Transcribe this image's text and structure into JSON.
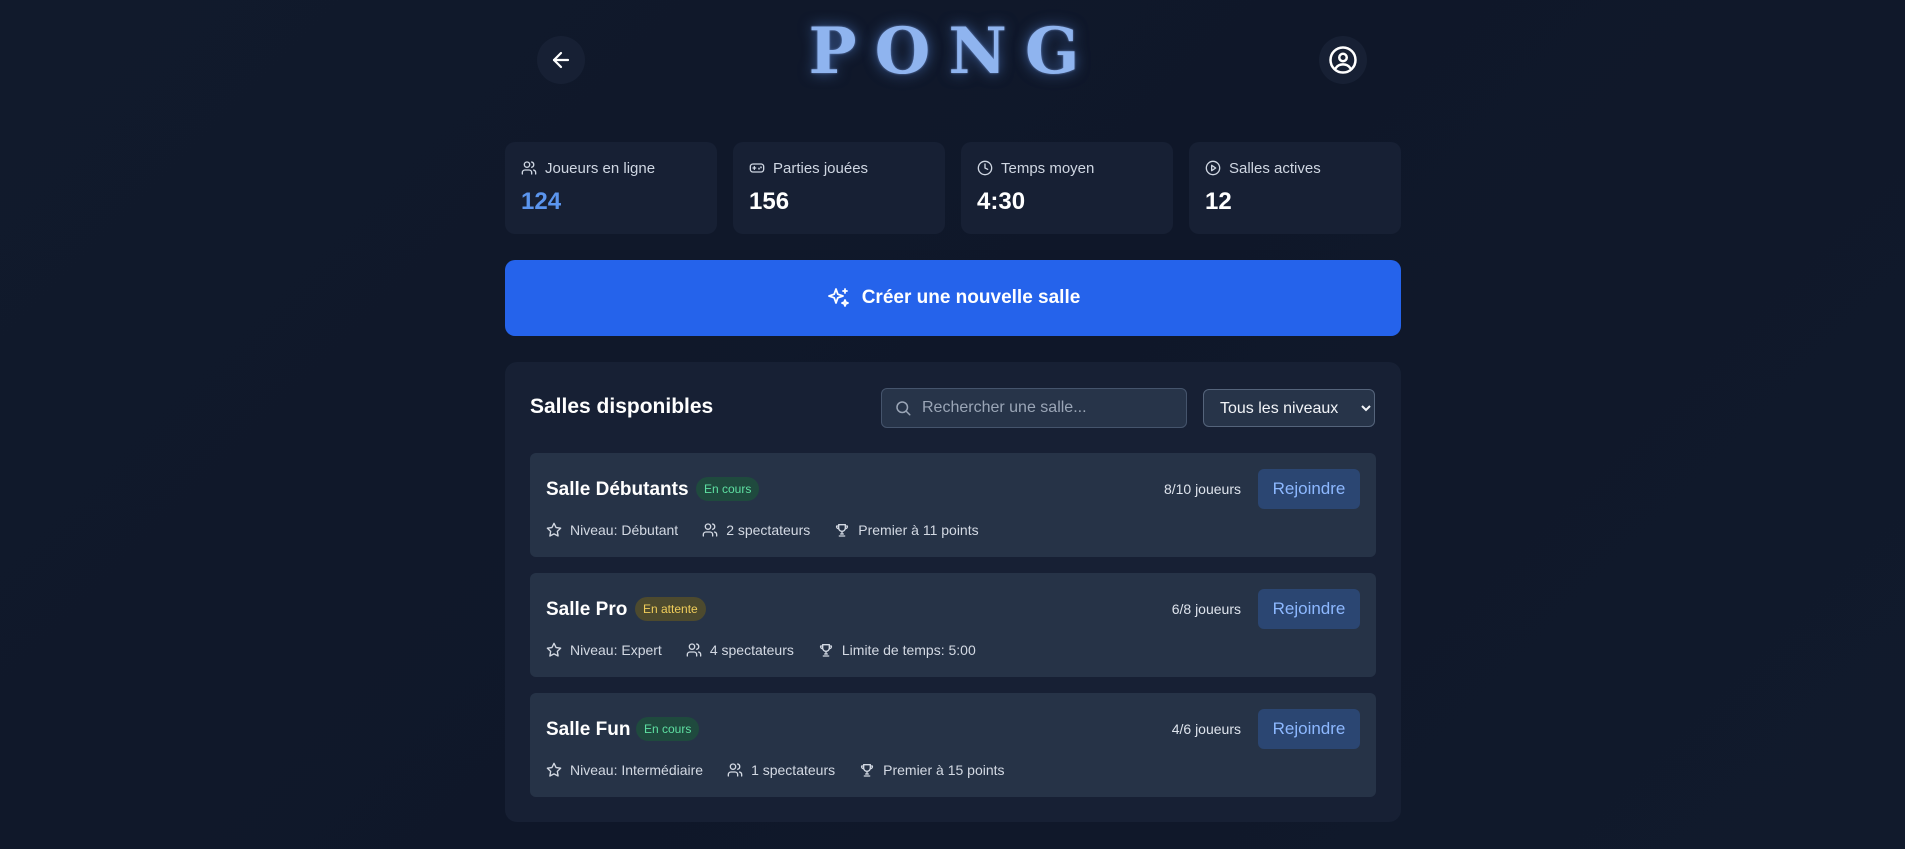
{
  "header": {
    "logo": "PONG",
    "back_icon": "arrow-left-icon",
    "profile_icon": "user-circle-icon"
  },
  "stats": [
    {
      "label": "Joueurs en ligne",
      "value": "124",
      "icon": "users-icon",
      "accent": true
    },
    {
      "label": "Parties jouées",
      "value": "156",
      "icon": "gamepad-icon",
      "accent": false
    },
    {
      "label": "Temps moyen",
      "value": "4:30",
      "icon": "clock-icon",
      "accent": false
    },
    {
      "label": "Salles actives",
      "value": "12",
      "icon": "play-circle-icon",
      "accent": false
    }
  ],
  "create_button": {
    "label": "Créer une nouvelle salle",
    "icon": "sparkles-icon"
  },
  "rooms_panel": {
    "title": "Salles disponibles",
    "search_placeholder": "Rechercher une salle...",
    "level_filter": {
      "selected": "Tous les niveaux"
    },
    "rooms": [
      {
        "name": "Salle Débutants",
        "status": "En cours",
        "status_color": "green",
        "players": "8/10 joueurs",
        "join_label": "Rejoindre",
        "level": "Niveau: Débutant",
        "spectators": "2 spectateurs",
        "rule": "Premier à 11 points"
      },
      {
        "name": "Salle Pro",
        "status": "En attente",
        "status_color": "yellow",
        "players": "6/8 joueurs",
        "join_label": "Rejoindre",
        "level": "Niveau: Expert",
        "spectators": "4 spectateurs",
        "rule": "Limite de temps: 5:00"
      },
      {
        "name": "Salle Fun",
        "status": "En cours",
        "status_color": "green",
        "players": "4/6 joueurs",
        "join_label": "Rejoindre",
        "level": "Niveau: Intermédiaire",
        "spectators": "1 spectateurs",
        "rule": "Premier à 15 points"
      }
    ]
  },
  "colors": {
    "background": "#0f1729",
    "card": "#172034",
    "primary": "#2563eb",
    "accent_value": "#5b95ee"
  }
}
